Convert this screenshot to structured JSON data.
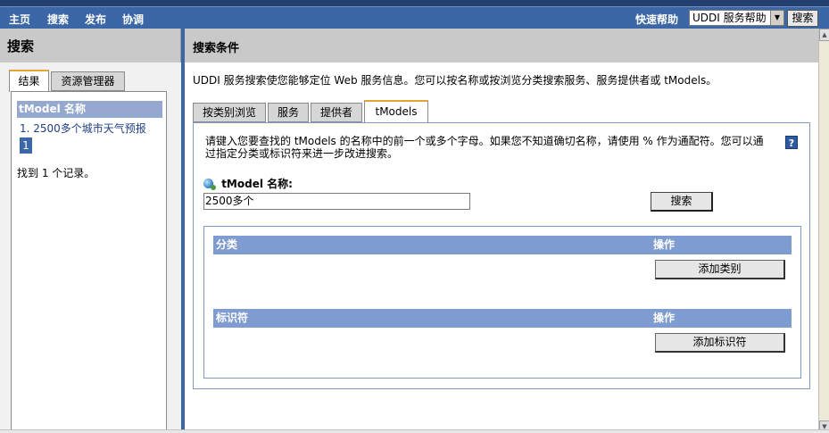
{
  "nav": {
    "items": [
      "主页",
      "搜索",
      "发布",
      "协调"
    ],
    "quick_help_label": "快速帮助",
    "help_select_value": "UDDI 服务帮助",
    "search_button": "搜索"
  },
  "left": {
    "title": "搜索",
    "tabs": [
      {
        "label": "结果",
        "active": true
      },
      {
        "label": "资源管理器",
        "active": false
      }
    ],
    "results_header": "tModel 名称",
    "results": [
      {
        "label": "1. 2500多个城市天气预报"
      }
    ],
    "page": "1",
    "count_text": "找到 1 个记录。"
  },
  "right": {
    "title": "搜索条件",
    "description": "UDDI 服务搜索使您能够定位 Web 服务信息。您可以按名称或按浏览分类搜索服务、服务提供者或 tModels。",
    "tabs": [
      {
        "label": "按类别浏览",
        "active": false
      },
      {
        "label": "服务",
        "active": false
      },
      {
        "label": "提供者",
        "active": false
      },
      {
        "label": "tModels",
        "active": true
      }
    ],
    "instructions": "请键入您要查找的 tModels 的名称中的前一个或多个字母。如果您不知道确切名称，请使用 % 作为通配符。您可以通过指定分类或标识符来进一步改进搜索。",
    "help_icon": "?",
    "name_label": "tModel 名称:",
    "name_value": "2500多个",
    "search_button": "搜索",
    "categories": {
      "header": "分类",
      "op_header": "操作",
      "button": "添加类别"
    },
    "identifiers": {
      "header": "标识符",
      "op_header": "操作",
      "button": "添加标识符"
    }
  },
  "icons": {
    "help": "help-icon",
    "field_bullet": "field-bullet-icon",
    "dropdown": "chevron-down-icon",
    "scroll_up": "scroll-up-arrow-icon",
    "scroll_down": "scroll-down-arrow-icon"
  },
  "colors": {
    "nav_bg": "#3b67a6",
    "panel_header_bg": "#c9c9c9",
    "table_header_bg": "#7f9cd0",
    "active_tab_accent": "#e8a337"
  }
}
